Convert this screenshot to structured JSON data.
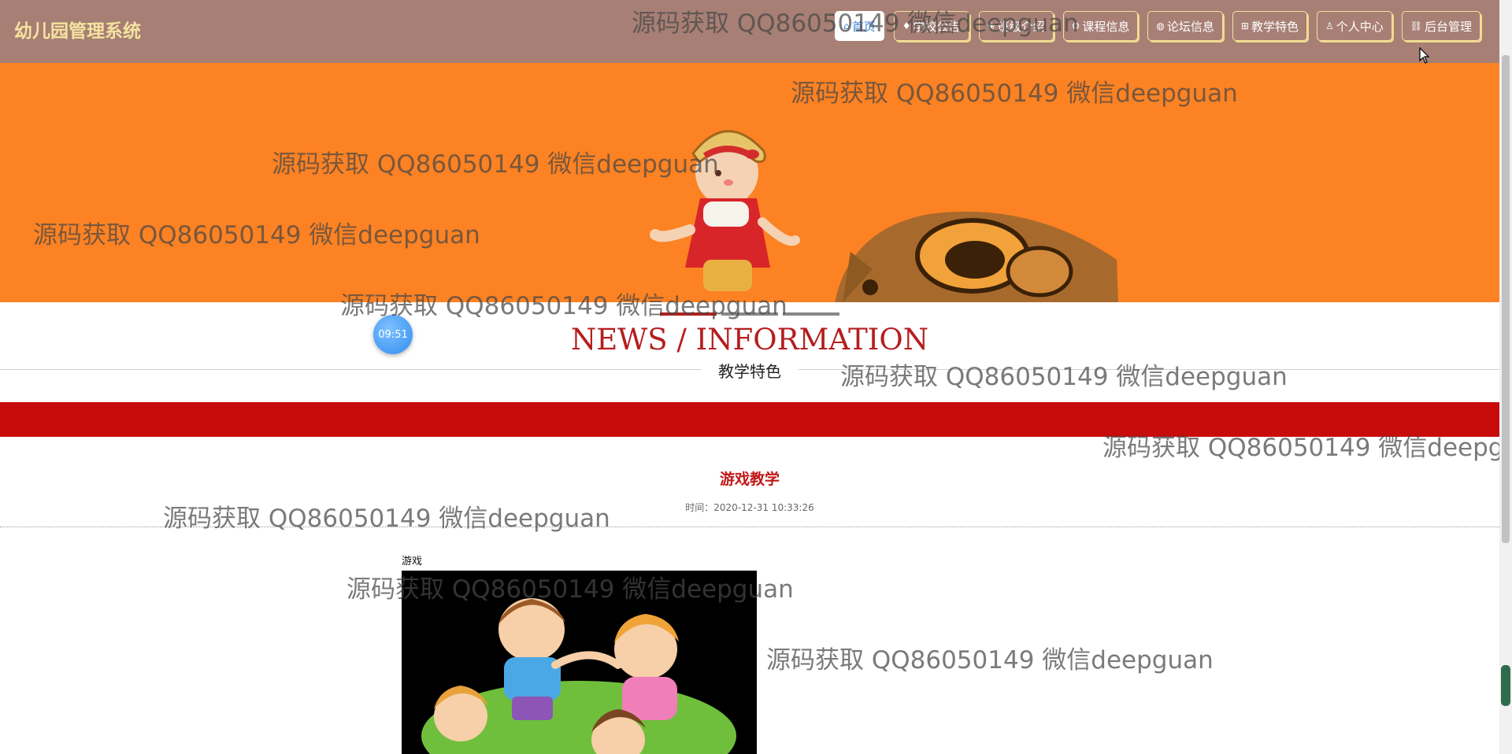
{
  "app": {
    "title": "幼儿园管理系统"
  },
  "nav": {
    "items": [
      {
        "icon": "home-icon",
        "glyph": "⌂",
        "label": "首页",
        "active": true
      },
      {
        "icon": "notice-icon",
        "glyph": "♦",
        "label": "学校公告"
      },
      {
        "icon": "class-icon",
        "glyph": "❀",
        "label": "班级介绍"
      },
      {
        "icon": "course-icon",
        "glyph": "⚙",
        "label": "课程信息"
      },
      {
        "icon": "forum-icon",
        "glyph": "◍",
        "label": "论坛信息"
      },
      {
        "icon": "teaching-icon",
        "glyph": "⊞",
        "label": "教学特色"
      },
      {
        "icon": "user-icon",
        "glyph": "♙",
        "label": "个人中心"
      },
      {
        "icon": "admin-link-icon",
        "glyph": "⛓",
        "label": "后台管理"
      }
    ]
  },
  "banner": {
    "slide_count": 3,
    "active_slide": 1
  },
  "clock": {
    "time": "09:51"
  },
  "section": {
    "title": "NEWS / INFORMATION",
    "subtitle": "教学特色"
  },
  "article": {
    "title": "游戏教学",
    "time": "时间：2020-12-31 10:33:26",
    "body": "游戏"
  },
  "watermark": {
    "text": "源码获取 QQ86050149 微信deepguan"
  },
  "colors": {
    "nav_bg": "#a77f74",
    "banner_bg": "#fc8223",
    "accent_red": "#c80b0b",
    "title_red": "#b51e1e"
  }
}
